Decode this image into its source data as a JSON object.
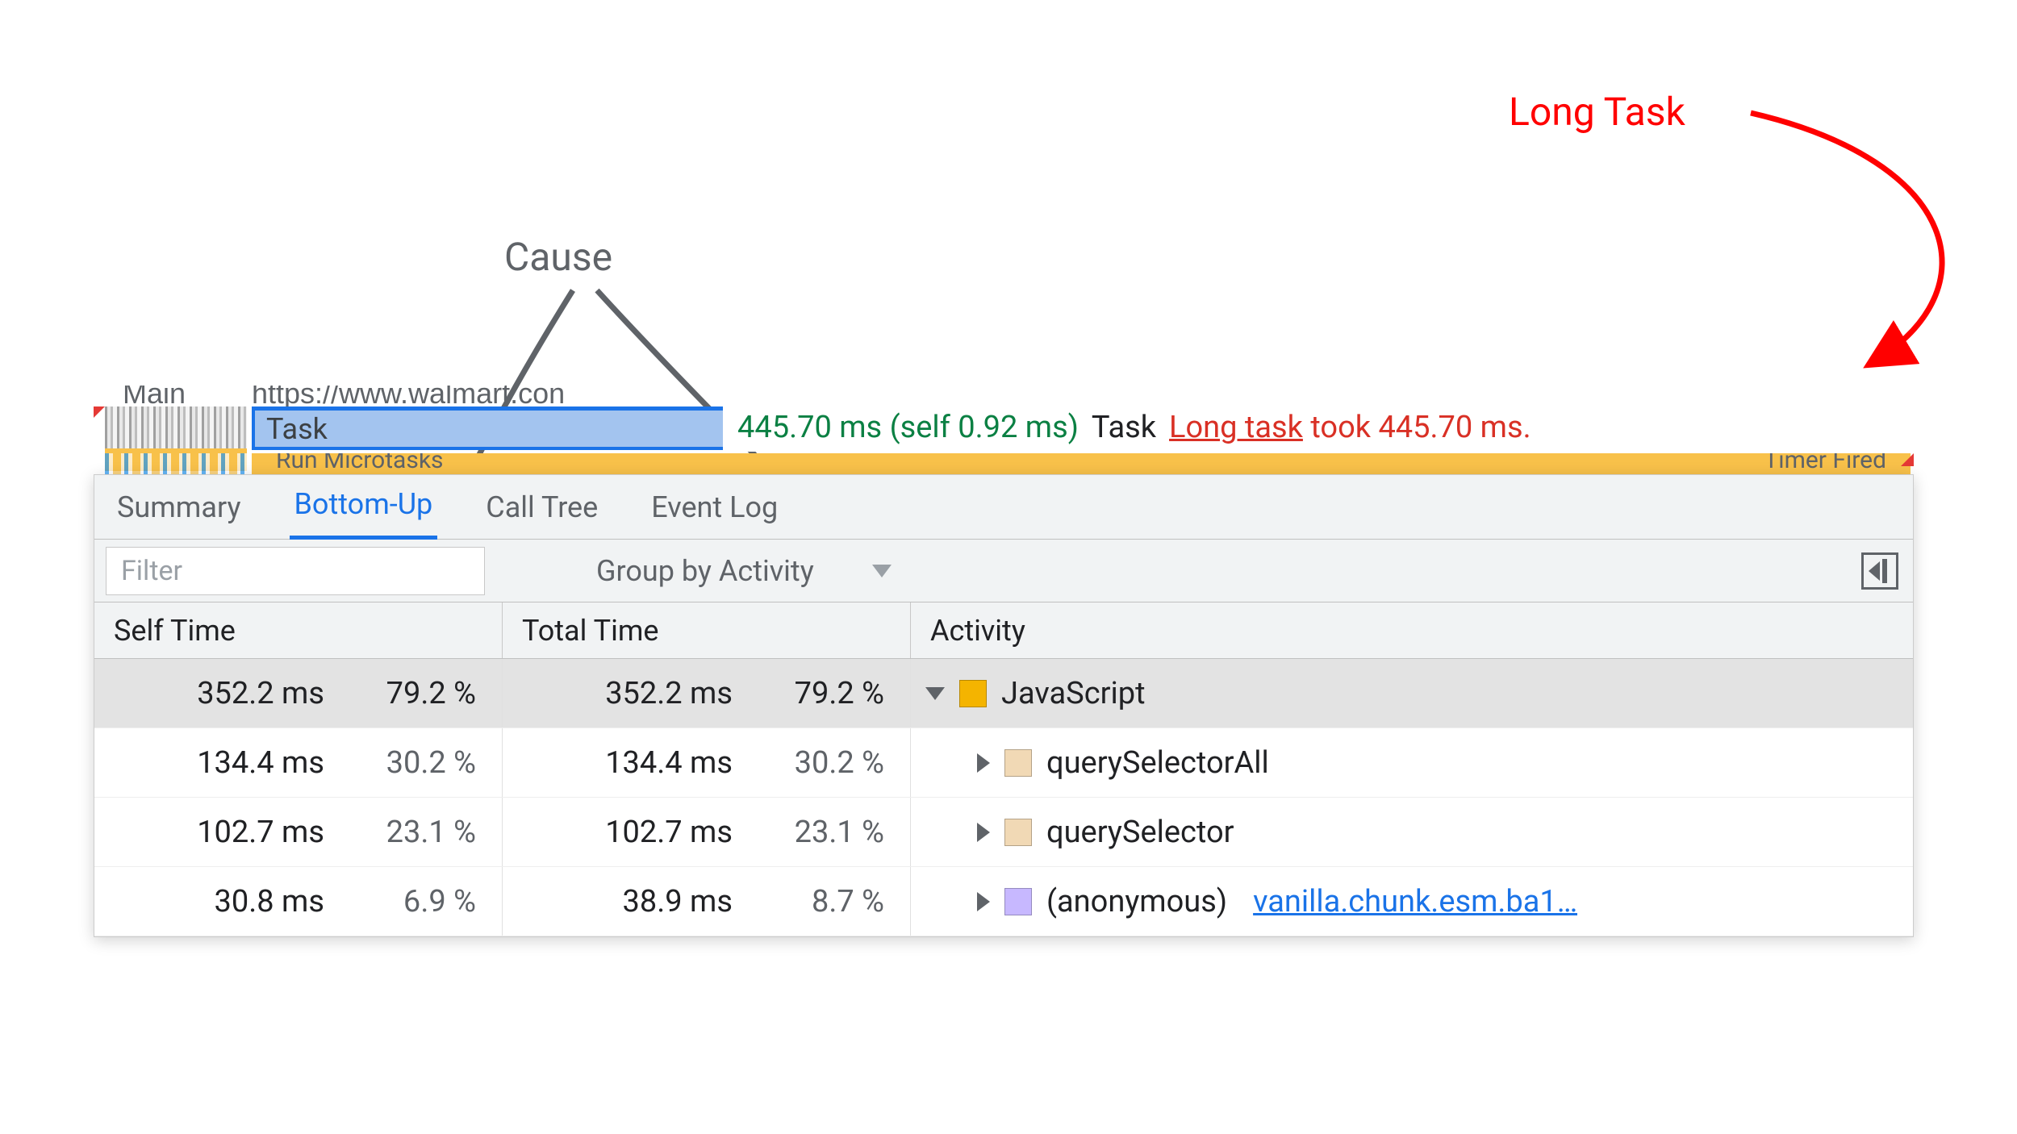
{
  "annotations": {
    "long_task": "Long Task",
    "cause": "Cause"
  },
  "flame": {
    "main_label": "Main",
    "url_label": "https://www.walmart.con",
    "task_label": "Task",
    "sub_left": "Run Microtasks",
    "sub_right": "Timer Fired",
    "tooltip": {
      "duration": "445.70 ms (self 0.92 ms)",
      "name": "Task",
      "warn_prefix": "Long task",
      "warn_rest": " took 445.70 ms."
    }
  },
  "tabs": {
    "summary": "Summary",
    "bottom_up": "Bottom-Up",
    "call_tree": "Call Tree",
    "event_log": "Event Log"
  },
  "filter": {
    "placeholder": "Filter",
    "group_by": "Group by Activity"
  },
  "headers": {
    "self": "Self Time",
    "total": "Total Time",
    "activity": "Activity"
  },
  "rows": [
    {
      "self_ms": "352.2 ms",
      "self_pct": "79.2 %",
      "self_bar": 79.2,
      "total_ms": "352.2 ms",
      "total_pct": "79.2 %",
      "total_bar": 79.2,
      "tri": "down",
      "swatch": "sw-yellow",
      "name": "JavaScript",
      "src": "",
      "selected": true,
      "indent": 0
    },
    {
      "self_ms": "134.4 ms",
      "self_pct": "30.2 %",
      "self_bar": 30.2,
      "total_ms": "134.4 ms",
      "total_pct": "30.2 %",
      "total_bar": 30.2,
      "tri": "right",
      "swatch": "sw-tan",
      "name": "querySelectorAll",
      "src": "",
      "selected": false,
      "indent": 1
    },
    {
      "self_ms": "102.7 ms",
      "self_pct": "23.1 %",
      "self_bar": 23.1,
      "total_ms": "102.7 ms",
      "total_pct": "23.1 %",
      "total_bar": 23.1,
      "tri": "right",
      "swatch": "sw-tan",
      "name": "querySelector",
      "src": "",
      "selected": false,
      "indent": 1
    },
    {
      "self_ms": "30.8 ms",
      "self_pct": "6.9 %",
      "self_bar": 6.9,
      "total_ms": "38.9 ms",
      "total_pct": "8.7 %",
      "total_bar": 8.7,
      "tri": "right",
      "swatch": "sw-violet",
      "name": "(anonymous)",
      "src": "vanilla.chunk.esm.ba1…",
      "selected": false,
      "indent": 1
    }
  ]
}
